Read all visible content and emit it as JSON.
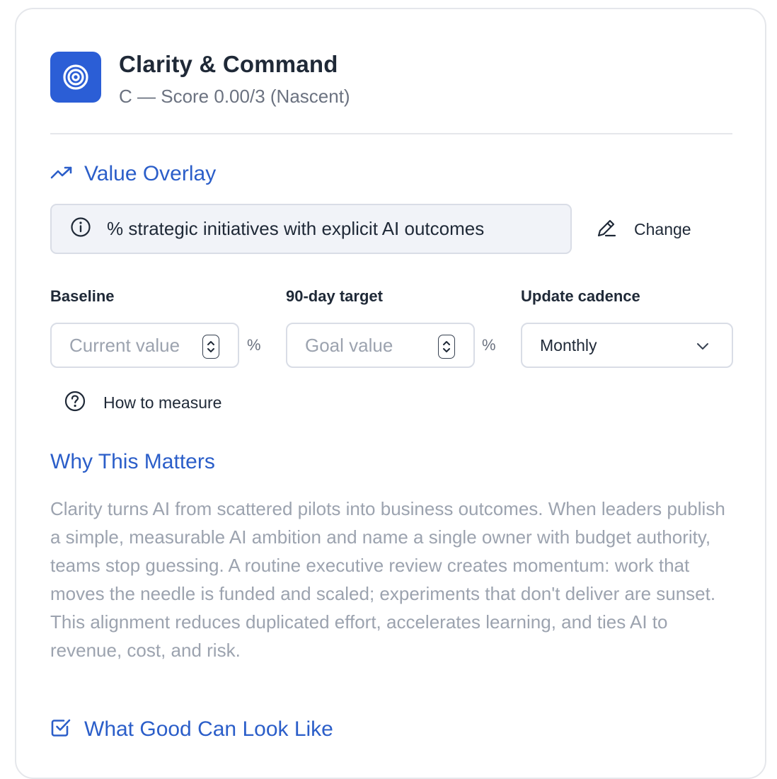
{
  "header": {
    "title": "Clarity & Command",
    "subtitle": "C — Score 0.00/3 (Nascent)",
    "icon": "target-icon",
    "accent_color": "#2b5ed6"
  },
  "value_overlay": {
    "heading": "Value Overlay",
    "icon": "trending-up-icon",
    "metric": "% strategic initiatives with explicit AI outcomes",
    "metric_icon": "info-icon",
    "change_label": "Change",
    "change_icon": "pencil-icon"
  },
  "fields": {
    "baseline": {
      "label": "Baseline",
      "placeholder": "Current value",
      "unit": "%"
    },
    "target": {
      "label": "90-day target",
      "placeholder": "Goal value",
      "unit": "%"
    },
    "cadence": {
      "label": "Update cadence",
      "value": "Monthly"
    }
  },
  "how_to": {
    "label": "How to measure",
    "icon": "help-circle-icon"
  },
  "why": {
    "heading": "Why This Matters",
    "body": "Clarity turns AI from scattered pilots into business outcomes. When leaders publish a simple, measurable AI ambition and name a single owner with budget authority, teams stop guessing. A routine executive review creates momentum: work that moves the needle is funded and scaled; experiments that don't deliver are sunset. This alignment reduces duplicated effort, accelerates learning, and ties AI to revenue, cost, and risk."
  },
  "good": {
    "heading": "What Good Can Look Like",
    "icon": "check-square-icon"
  }
}
